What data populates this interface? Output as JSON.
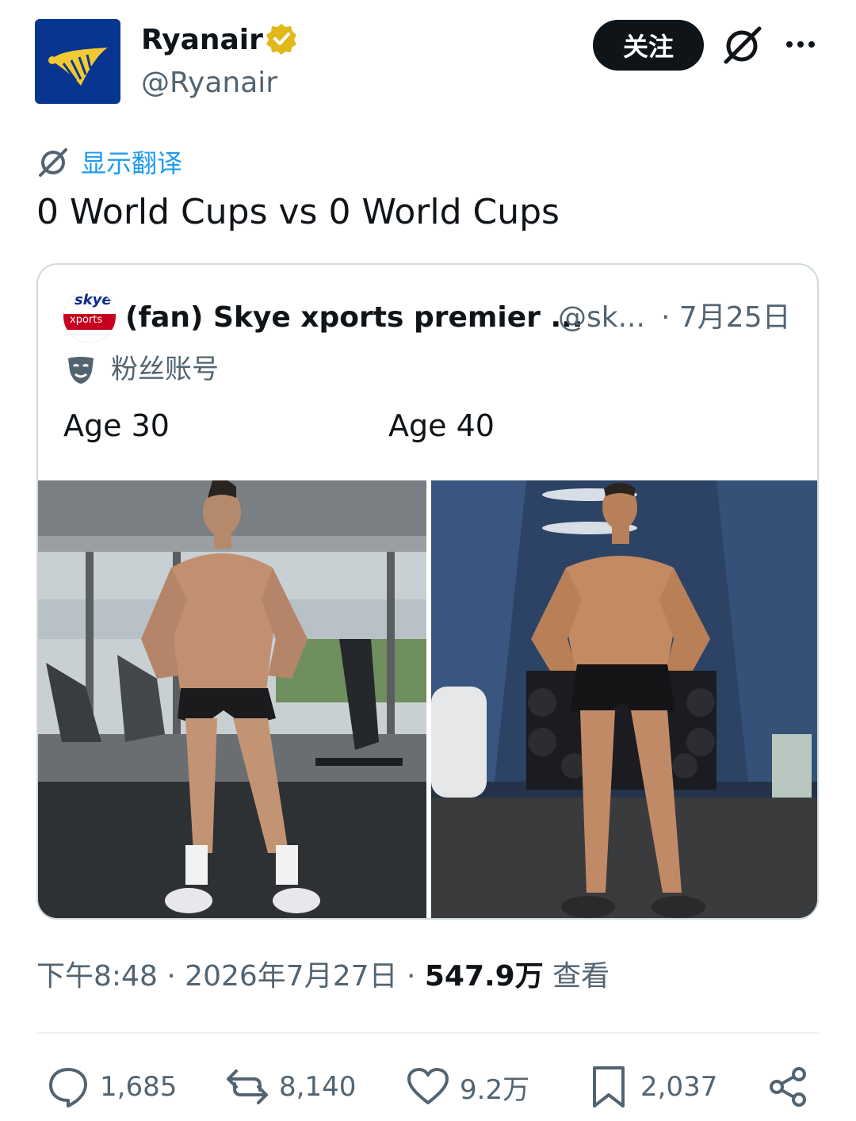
{
  "header": {
    "display_name": "Ryanair",
    "handle": "@Ryanair",
    "follow_label": "关注",
    "brand_color": "#073590",
    "logo_color": "#f1c933"
  },
  "translate": {
    "label": "显示翻译"
  },
  "tweet": {
    "text": "0 World Cups vs 0 World Cups"
  },
  "quote": {
    "avatar_text": "skye",
    "avatar_sub": "xports",
    "display_name": "(fan) Skye xports premier ...",
    "handle": "@sk...",
    "date": "· 7月25日",
    "fan_label": "粉丝账号",
    "caption_left": "Age 30",
    "caption_right": "Age 40"
  },
  "meta": {
    "time_date": "下午8:48 · 2026年7月27日 · ",
    "views": "547.9万",
    "views_label": " 查看"
  },
  "actions": {
    "replies": "1,685",
    "reposts": "8,140",
    "likes": "9.2万",
    "bookmarks": "2,037"
  }
}
